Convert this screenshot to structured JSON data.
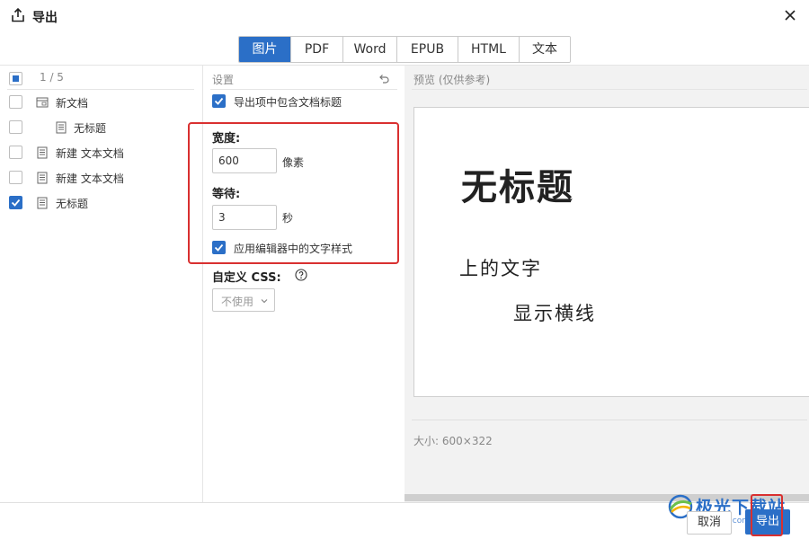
{
  "header": {
    "title": "导出",
    "icon": "share-upload-icon",
    "close_icon": "close-icon"
  },
  "tabs": [
    {
      "label": "图片",
      "active": true
    },
    {
      "label": "PDF",
      "active": false
    },
    {
      "label": "Word",
      "active": false
    },
    {
      "label": "EPUB",
      "active": false
    },
    {
      "label": "HTML",
      "active": false
    },
    {
      "label": "文本",
      "active": false
    }
  ],
  "doc_list": {
    "count": "1 / 5",
    "items": [
      {
        "label": "新文档",
        "checked": false,
        "icon": "folder-doc-icon",
        "indent": 0
      },
      {
        "label": "无标题",
        "checked": false,
        "icon": "document-icon",
        "indent": 1
      },
      {
        "label": "新建 文本文档",
        "checked": false,
        "icon": "document-icon",
        "indent": 0
      },
      {
        "label": "新建 文本文档",
        "checked": false,
        "icon": "document-icon",
        "indent": 0
      },
      {
        "label": "无标题",
        "checked": true,
        "icon": "document-icon",
        "indent": 0
      }
    ]
  },
  "settings": {
    "title": "设置",
    "include_title_label": "导出项中包含文档标题",
    "include_title_checked": true,
    "width_label": "宽度:",
    "width_value": "600",
    "width_unit": "像素",
    "wait_label": "等待:",
    "wait_value": "3",
    "wait_unit": "秒",
    "apply_style_label": "应用编辑器中的文字样式",
    "apply_style_checked": true,
    "custom_css_label": "自定义 CSS:",
    "custom_css_select": "不使用"
  },
  "preview": {
    "title": "预览 (仅供参考)",
    "doc_title": "无标题",
    "line1": "上的文字",
    "line2": "显示横线",
    "size": "大小: 600×322"
  },
  "footer": {
    "cancel_label": "取消",
    "export_label": "导出"
  },
  "watermark": {
    "text": "极光下载站",
    "url": "www.xz7.com"
  },
  "colors": {
    "accent": "#2b6fc7",
    "highlight": "#d93030"
  }
}
